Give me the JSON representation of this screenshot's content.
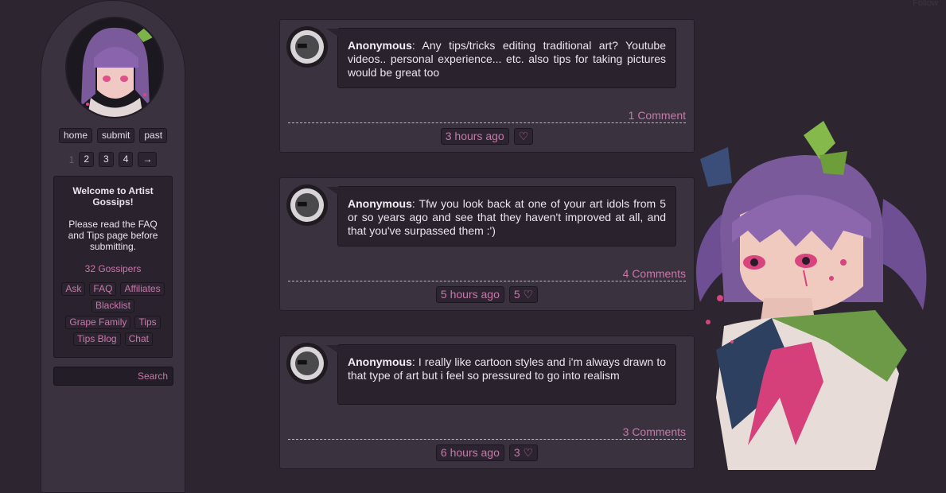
{
  "top_controls": {
    "follow": "Follow"
  },
  "sidebar": {
    "nav": [
      "home",
      "submit",
      "past"
    ],
    "pager": {
      "current": "1",
      "pages": [
        "2",
        "3",
        "4"
      ],
      "next": "→"
    },
    "welcome_title": "Welcome to Artist Gossips!",
    "welcome_body": "Please read the FAQ and Tips page before submitting.",
    "gossipers": "32 Gossipers",
    "links": [
      "Ask",
      "FAQ",
      "Affiliates",
      "Blacklist",
      "Grape Family",
      "Tips",
      "Tips Blog",
      "Chat"
    ],
    "search_label": "Search"
  },
  "posts": [
    {
      "author": "Anonymous",
      "text": ": Any tips/tricks editing traditional art? Youtube videos.. personal experience... etc. also tips for taking pictures would be great too",
      "comments": "1 Comment",
      "time": "3 hours ago",
      "likes": "♡"
    },
    {
      "author": "Anonymous",
      "text": ": Tfw you look back at one of your art idols from 5 or so years ago and see that they haven't improved at all, and that you've surpassed them :')",
      "comments": "4 Comments",
      "time": "5 hours ago",
      "likes": "5 ♡"
    },
    {
      "author": "Anonymous",
      "text": ": I really like cartoon styles and i'm always drawn to that type of art but i feel so pressured to go into realism",
      "comments": "3 Comments",
      "time": "6 hours ago",
      "likes": "3 ♡"
    }
  ],
  "colors": {
    "accent": "#c878aa",
    "background": "#2d2630",
    "panel": "#3b3240"
  }
}
